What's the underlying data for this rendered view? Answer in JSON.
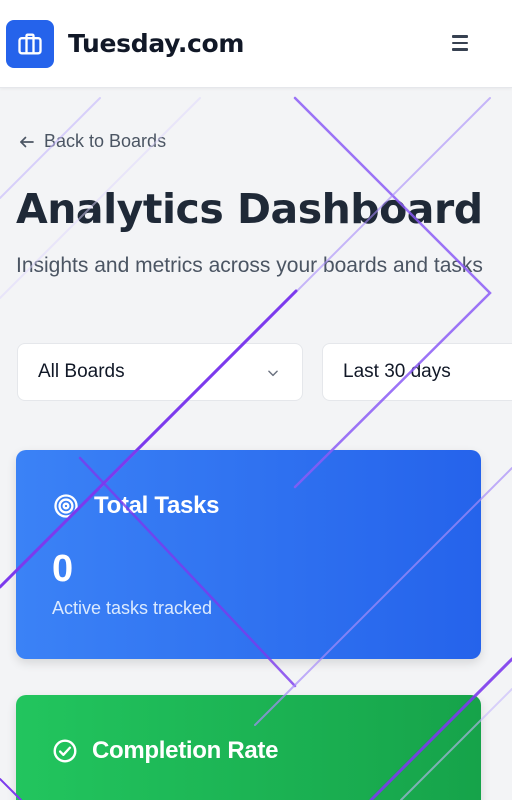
{
  "header": {
    "brand": "Tuesday.com",
    "logo_icon": "briefcase-icon",
    "menu_icon": "hamburger-menu-icon"
  },
  "nav": {
    "back_label": "Back to Boards"
  },
  "page": {
    "title": "Analytics Dashboard",
    "subtitle": "Insights and metrics across your boards and tasks"
  },
  "filters": {
    "board_select": "All Boards",
    "range_select": "Last 30 days"
  },
  "cards": {
    "total_tasks": {
      "title": "Total Tasks",
      "value": "0",
      "subtitle": "Active tasks tracked",
      "icon": "target-icon",
      "color": "#3b82f6"
    },
    "completion_rate": {
      "title": "Completion Rate",
      "icon": "check-circle-icon",
      "color": "#22c55e"
    }
  },
  "colors": {
    "accent": "#2563eb",
    "background": "#f3f4f6",
    "decor": "#8b5cf6"
  }
}
